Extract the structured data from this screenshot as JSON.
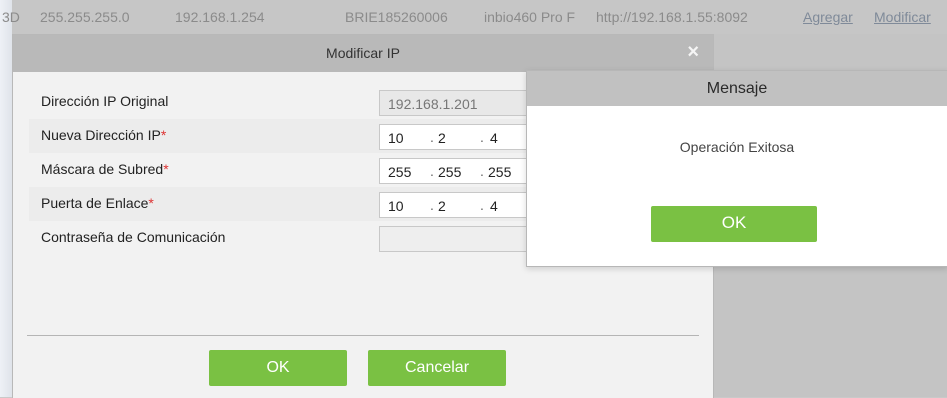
{
  "background_row": {
    "col_fragment": "3D",
    "mask": "255.255.255.0",
    "gateway": "192.168.1.254",
    "serial": "BRIE185260006",
    "device": "inbio460 Pro F",
    "url": "http://192.168.1.55:8092",
    "link_add": "Agregar",
    "link_modify": "Modificar"
  },
  "dialog": {
    "title": "Modificar IP",
    "close_glyph": "×",
    "fields": {
      "original_ip": {
        "label": "Dirección IP Original",
        "value": "192.168.1.201"
      },
      "new_ip": {
        "label": "Nueva Dirección IP",
        "required": "*",
        "segments": [
          "10",
          "2",
          "4",
          ""
        ]
      },
      "subnet": {
        "label": "Máscara de Subred",
        "required": "*",
        "segments": [
          "255",
          "255",
          "255",
          ""
        ]
      },
      "gateway": {
        "label": "Puerta de Enlace",
        "required": "*",
        "segments": [
          "10",
          "2",
          "4",
          ""
        ]
      },
      "comm_password": {
        "label": "Contraseña de Comunicación",
        "value": ""
      }
    },
    "ok_label": "OK",
    "cancel_label": "Cancelar"
  },
  "message": {
    "title": "Mensaje",
    "text": "Operación Exitosa",
    "ok_label": "OK"
  },
  "colors": {
    "accent_green": "#7ac143",
    "required_red": "#d33333",
    "header_gray": "#b9b9b9"
  }
}
